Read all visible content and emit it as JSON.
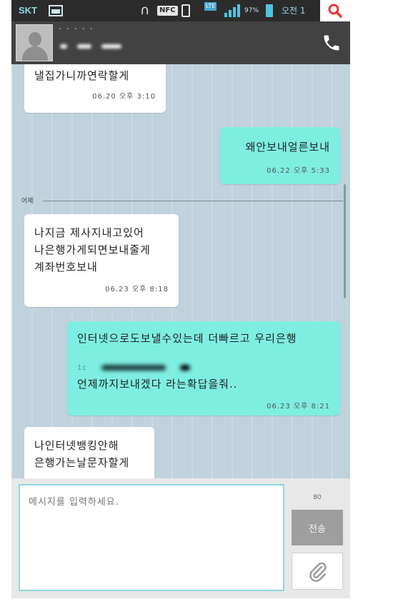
{
  "status_bar": {
    "carrier": "SKT",
    "nfc_label": "NFC",
    "lte_label": "LTE",
    "battery_percent": "97%",
    "clock": "오전 1"
  },
  "contact": {
    "name": "· · · · ·"
  },
  "messages": [
    {
      "direction": "in",
      "text": "낼집가니까연락할게",
      "time": "06.20 오후 3:10"
    },
    {
      "direction": "out",
      "text": "왜안보내얼른보내",
      "time": "06.22 오후 5:33"
    },
    {
      "direction": "in",
      "text": "나지금 제사지내고있어\n나은행가게되면보내줄게\n계좌번호보내",
      "time": "06.23 오후 8:18"
    },
    {
      "direction": "out",
      "text_line1": "인터넷으로도보낼수있는데 더빠르고 우리은행",
      "text_line2": "1c",
      "text_line3": "언제까지보내겠다 라는확답을줘..",
      "time": "06.23 오후 8:21"
    },
    {
      "direction": "in",
      "text": "나인터넷뱅킹안해\n은행가는날문자할게"
    }
  ],
  "date_separator": "어제",
  "compose": {
    "placeholder": "메시지를 입력하세요.",
    "char_count": "80",
    "send_label": "전송"
  },
  "colors": {
    "status_bar": "#2b2b2b",
    "header": "#424242",
    "conversation_bg": "#c0d2dc",
    "incoming_bubble": "#ffffff",
    "outgoing_bubble": "#7eeee2",
    "search_icon": "#e53935"
  },
  "icons": {
    "search": "search-icon",
    "call": "phone-icon",
    "attach": "paperclip-icon"
  }
}
